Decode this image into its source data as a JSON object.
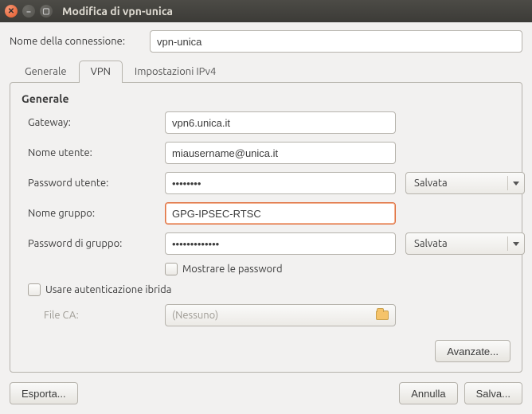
{
  "window": {
    "title": "Modifica di vpn-unica"
  },
  "connection": {
    "label": "Nome della connessione:",
    "value": "vpn-unica"
  },
  "tabs": {
    "general": "Generale",
    "vpn": "VPN",
    "ipv4": "Impostazioni IPv4",
    "active": "vpn"
  },
  "section": {
    "title": "Generale"
  },
  "fields": {
    "gateway": {
      "label": "Gateway:",
      "value": "vpn6.unica.it"
    },
    "username": {
      "label": "Nome utente:",
      "value": "miausername@unica.it"
    },
    "userpass": {
      "label": "Password utente:",
      "value": "••••••••",
      "store": "Salvata"
    },
    "groupname": {
      "label": "Nome gruppo:",
      "value": "GPG-IPSEC-RTSC"
    },
    "grouppass": {
      "label": "Password di gruppo:",
      "value": "•••••••••••••",
      "store": "Salvata"
    },
    "showpass": {
      "label": "Mostrare le password",
      "checked": false
    },
    "hybrid": {
      "label": "Usare autenticazione ibrida",
      "checked": false
    },
    "fileca": {
      "label": "File CA:",
      "value": "(Nessuno)"
    }
  },
  "buttons": {
    "advanced": "Avanzate...",
    "export": "Esporta...",
    "cancel": "Annulla",
    "save": "Salva..."
  }
}
